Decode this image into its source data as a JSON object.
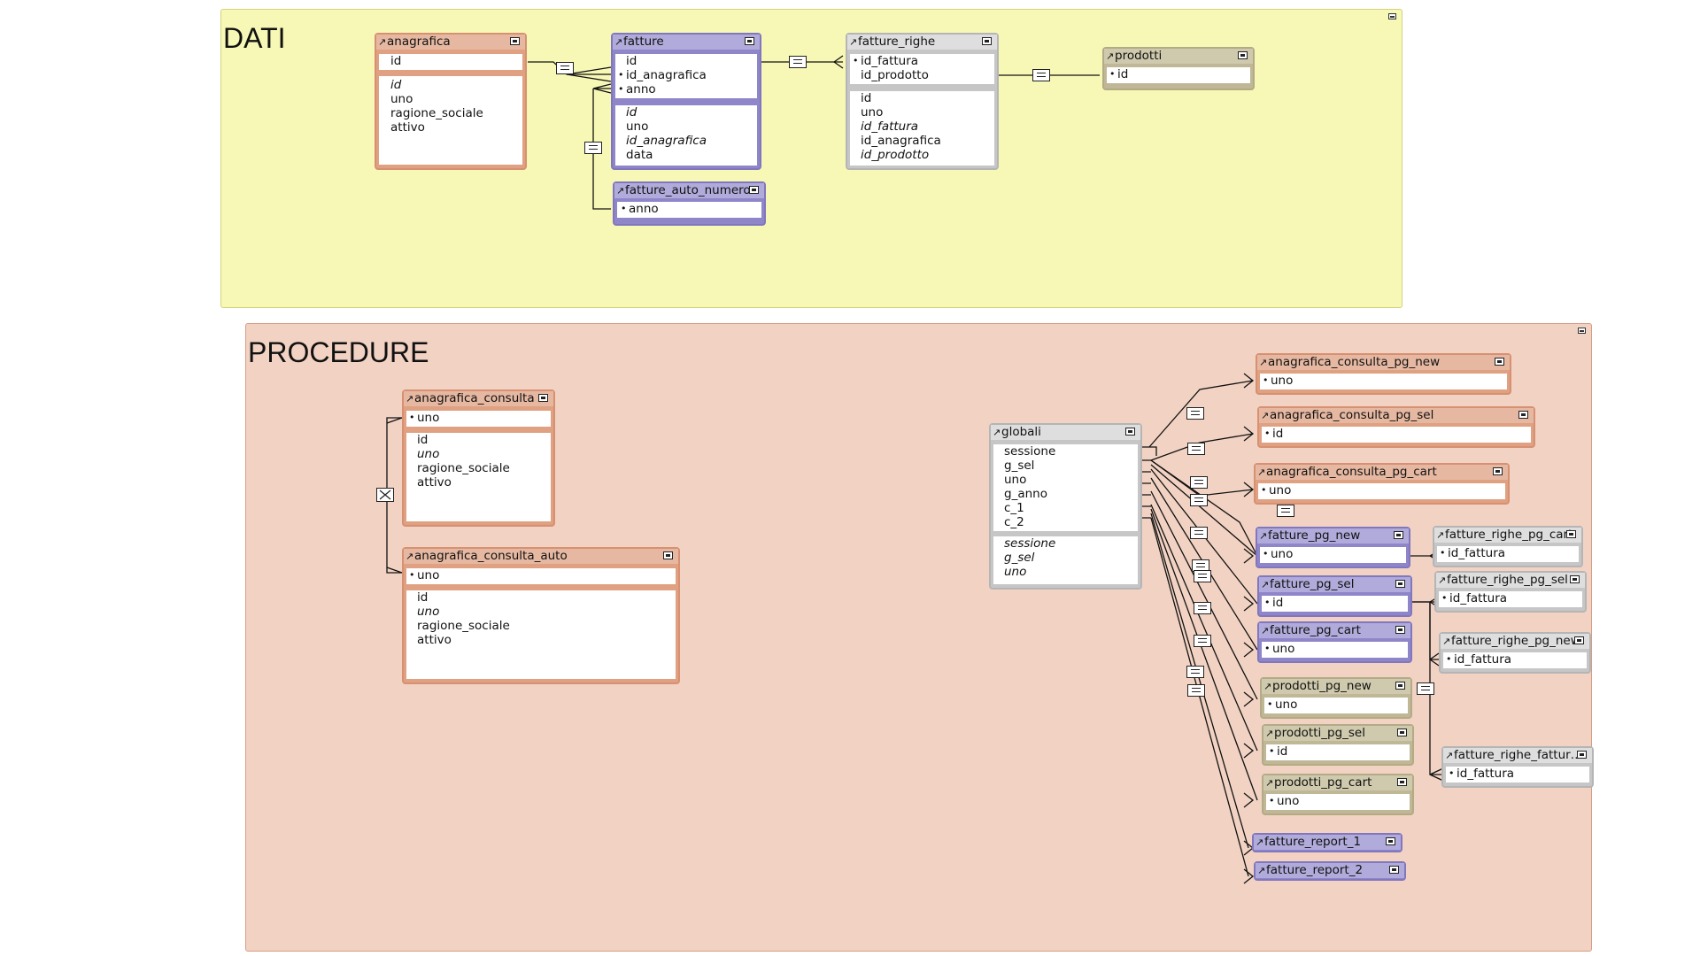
{
  "groups": {
    "dati": {
      "title": "DATI"
    },
    "procedure": {
      "title": "PROCEDURE"
    }
  },
  "tables": {
    "anagrafica": {
      "name": "anagrafica",
      "keys": [
        "id"
      ],
      "fields": [
        "id",
        "uno",
        "ragione_sociale",
        "attivo"
      ]
    },
    "fatture": {
      "name": "fatture",
      "keys": [
        "id",
        "id_anagrafica",
        "anno"
      ],
      "fields": [
        "id",
        "uno",
        "id_anagrafica",
        "data"
      ]
    },
    "fatture_righe": {
      "name": "fatture_righe",
      "keys": [
        "id_fattura",
        "id_prodotto"
      ],
      "fields": [
        "id",
        "uno",
        "id_fattura",
        "id_anagrafica",
        "id_prodotto"
      ]
    },
    "prodotti": {
      "name": "prodotti",
      "keys": [
        "id"
      ]
    },
    "fatture_auto_numero": {
      "name": "fatture_auto_numero",
      "keys": [
        "anno"
      ]
    },
    "anagrafica_consulta": {
      "name": "anagrafica_consulta",
      "keys": [
        "uno"
      ],
      "fields": [
        "id",
        "uno",
        "ragione_sociale",
        "attivo"
      ]
    },
    "anagrafica_consulta_auto": {
      "name": "anagrafica_consulta_auto",
      "keys": [
        "uno"
      ],
      "fields": [
        "id",
        "uno",
        "ragione_sociale",
        "attivo"
      ]
    },
    "globali": {
      "name": "globali",
      "keys": [
        "sessione",
        "g_sel",
        "uno",
        "g_anno",
        "c_1",
        "c_2"
      ],
      "fields": [
        "sessione",
        "g_sel",
        "uno"
      ]
    },
    "anagrafica_consulta_pg_new": {
      "name": "anagrafica_consulta_pg_new",
      "keys": [
        "uno"
      ]
    },
    "anagrafica_consulta_pg_sel": {
      "name": "anagrafica_consulta_pg_sel",
      "keys": [
        "id"
      ]
    },
    "anagrafica_consulta_pg_cart": {
      "name": "anagrafica_consulta_pg_cart",
      "keys": [
        "uno"
      ]
    },
    "fatture_pg_new": {
      "name": "fatture_pg_new",
      "keys": [
        "uno"
      ]
    },
    "fatture_pg_sel": {
      "name": "fatture_pg_sel",
      "keys": [
        "id"
      ]
    },
    "fatture_pg_cart": {
      "name": "fatture_pg_cart",
      "keys": [
        "uno"
      ]
    },
    "prodotti_pg_new": {
      "name": "prodotti_pg_new",
      "keys": [
        "uno"
      ]
    },
    "prodotti_pg_sel": {
      "name": "prodotti_pg_sel",
      "keys": [
        "id"
      ]
    },
    "prodotti_pg_cart": {
      "name": "prodotti_pg_cart",
      "keys": [
        "uno"
      ]
    },
    "fatture_report_1": {
      "name": "fatture_report_1"
    },
    "fatture_report_2": {
      "name": "fatture_report_2"
    },
    "fatture_righe_pg_cart": {
      "name": "fatture_righe_pg_cart",
      "keys": [
        "id_fattura"
      ]
    },
    "fatture_righe_pg_sel": {
      "name": "fatture_righe_pg_sel",
      "keys": [
        "id_fattura"
      ]
    },
    "fatture_righe_pg_new": {
      "name": "fatture_righe_pg_new",
      "keys": [
        "id_fattura"
      ]
    },
    "fatture_righe_fattur": {
      "name": "fatture_righe_fattur…",
      "keys": [
        "id_fattura"
      ]
    }
  },
  "colors": {
    "dati_bg": "#f8f8b6",
    "procedure_bg": "#f2d3c3",
    "orange": "#dfa182",
    "purple": "#8f86c9",
    "gray": "#c6c6c6",
    "khaki": "#bfb796"
  },
  "icons": {
    "header_arrow": "↗",
    "collapse": "minimize-box"
  }
}
